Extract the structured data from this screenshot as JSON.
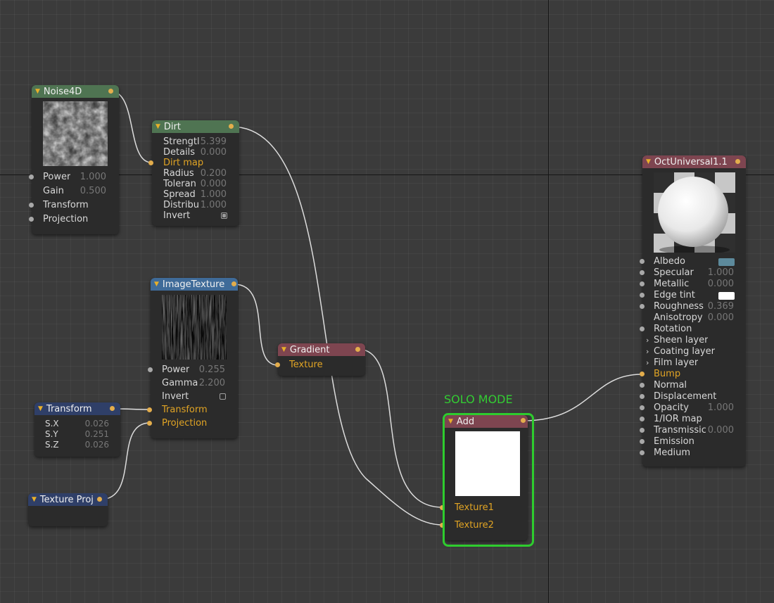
{
  "nodes": {
    "noise4d": {
      "title": "Noise4D",
      "params": [
        {
          "label": "Power",
          "value": "1.000"
        },
        {
          "label": "Gain",
          "value": "0.500"
        },
        {
          "label": "Transform",
          "value": ""
        },
        {
          "label": "Projection",
          "value": ""
        }
      ]
    },
    "dirt": {
      "title": "Dirt",
      "params": [
        {
          "label": "Strengtl",
          "value": "5.399"
        },
        {
          "label": "Details",
          "value": "0.000"
        },
        {
          "label": "Dirt map",
          "value": ""
        },
        {
          "label": "Radius",
          "value": "0.200"
        },
        {
          "label": "Toleran",
          "value": "0.000"
        },
        {
          "label": "Spread",
          "value": "1.000"
        },
        {
          "label": "Distribu",
          "value": "1.000"
        },
        {
          "label": "Invert",
          "value": ""
        }
      ]
    },
    "image_texture": {
      "title": "ImageTexture",
      "params": [
        {
          "label": "Power",
          "value": "0.255"
        },
        {
          "label": "Gamma",
          "value": "2.200"
        },
        {
          "label": "Invert",
          "value": ""
        },
        {
          "label": "Transform",
          "value": ""
        },
        {
          "label": "Projection",
          "value": ""
        }
      ]
    },
    "gradient": {
      "title": "Gradient",
      "params": [
        {
          "label": "Texture",
          "value": ""
        }
      ]
    },
    "transform": {
      "title": "Transform",
      "params": [
        {
          "label": "S.X",
          "value": "0.026"
        },
        {
          "label": "S.Y",
          "value": "0.251"
        },
        {
          "label": "S.Z",
          "value": "0.026"
        }
      ]
    },
    "texture_proj": {
      "title": "Texture Proj"
    },
    "add": {
      "title": "Add",
      "params": [
        {
          "label": "Texture1",
          "value": ""
        },
        {
          "label": "Texture2",
          "value": ""
        }
      ]
    },
    "oct_universal": {
      "title": "OctUniversal1.1",
      "params": [
        {
          "label": "Albedo",
          "value": ""
        },
        {
          "label": "Specular",
          "value": "1.000"
        },
        {
          "label": "Metallic",
          "value": "0.000"
        },
        {
          "label": "Edge tint",
          "value": ""
        },
        {
          "label": "Roughness",
          "value": "0.369"
        },
        {
          "label": "Anisotropy",
          "value": "0.000"
        },
        {
          "label": "Rotation",
          "value": ""
        },
        {
          "label": "Sheen layer",
          "value": ""
        },
        {
          "label": "Coating layer",
          "value": ""
        },
        {
          "label": "Film layer",
          "value": ""
        },
        {
          "label": "Bump",
          "value": ""
        },
        {
          "label": "Normal",
          "value": ""
        },
        {
          "label": "Displacement",
          "value": ""
        },
        {
          "label": "Opacity",
          "value": "1.000"
        },
        {
          "label": "1/IOR map",
          "value": ""
        },
        {
          "label": "Transmissic",
          "value": "0.000"
        },
        {
          "label": "Emission",
          "value": ""
        },
        {
          "label": "Medium",
          "value": ""
        }
      ]
    }
  },
  "solo_mode_label": "SOLO MODE",
  "colors": {
    "connected_pin": "#e3ad4c",
    "unconnected_pin": "#a8a8a8",
    "connected_label": "#e1a424",
    "solo_highlight": "#2ecc2e",
    "albedo_swatch": "#5d8a9c",
    "edge_tint_swatch": "#ffffff"
  },
  "icons": [
    "collapse-triangle-icon",
    "expand-chevron-icon",
    "checkbox-icon"
  ]
}
